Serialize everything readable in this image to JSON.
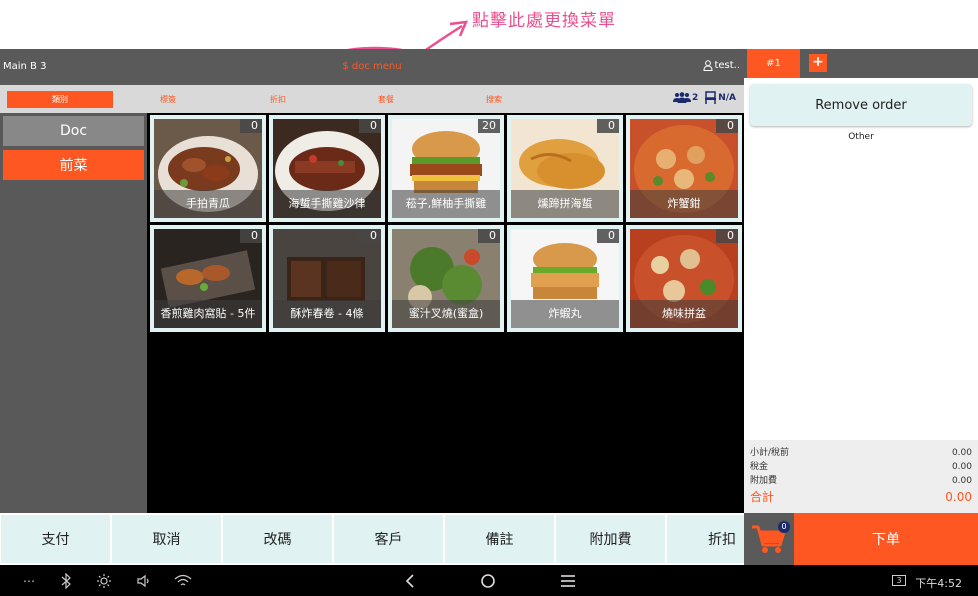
{
  "annotation": {
    "text": "點擊此處更換菜單"
  },
  "topbar": {
    "table": "Main B 3",
    "menu_name": "$ doc menu",
    "user": "test.."
  },
  "categories": {
    "tabs": [
      "類別",
      "標簽",
      "折扣",
      "套餐",
      "搜索"
    ],
    "guests": "2",
    "seat": "N/A"
  },
  "left_menu": [
    {
      "label": "Doc"
    },
    {
      "label": "前菜"
    }
  ],
  "dishes": [
    {
      "name": "手拍青瓜",
      "qty": "0"
    },
    {
      "name": "海蜇手撕雞沙律",
      "qty": "0"
    },
    {
      "name": "菘子,鮮柚手撕雞",
      "qty": "20"
    },
    {
      "name": "燻蹄拼海蜇",
      "qty": "0"
    },
    {
      "name": "炸蟹鉗",
      "qty": "0"
    },
    {
      "name": "香煎雞肉窩貼 - 5件",
      "qty": "0"
    },
    {
      "name": "酥炸春卷 - 4條",
      "qty": "0"
    },
    {
      "name": "蜜汁叉燒(蜜盒)",
      "qty": "0"
    },
    {
      "name": "炸蝦丸",
      "qty": "0"
    },
    {
      "name": "燒味拼盆",
      "qty": "0"
    }
  ],
  "bottom_buttons": [
    "支付",
    "取消",
    "改碼",
    "客戶",
    "備註",
    "附加費",
    "折扣"
  ],
  "order_panel": {
    "tab": "#1",
    "remove_label": "Remove order",
    "group_label": "Other",
    "subtotal_label": "小計/稅前",
    "subtotal": "0.00",
    "tax_label": "稅金",
    "tax": "0.00",
    "surcharge_label": "附加費",
    "surcharge": "0.00",
    "total_label": "合計",
    "total": "0.00",
    "cart_count": "0",
    "order_label": "下单"
  },
  "system_bar": {
    "time": "下午4:52",
    "badge": "3"
  },
  "colors": {
    "accent": "#ff5722",
    "panel_bg": "#e0f2f1",
    "dark": "#5a5a5a",
    "annotation": "#ec4f8f"
  }
}
